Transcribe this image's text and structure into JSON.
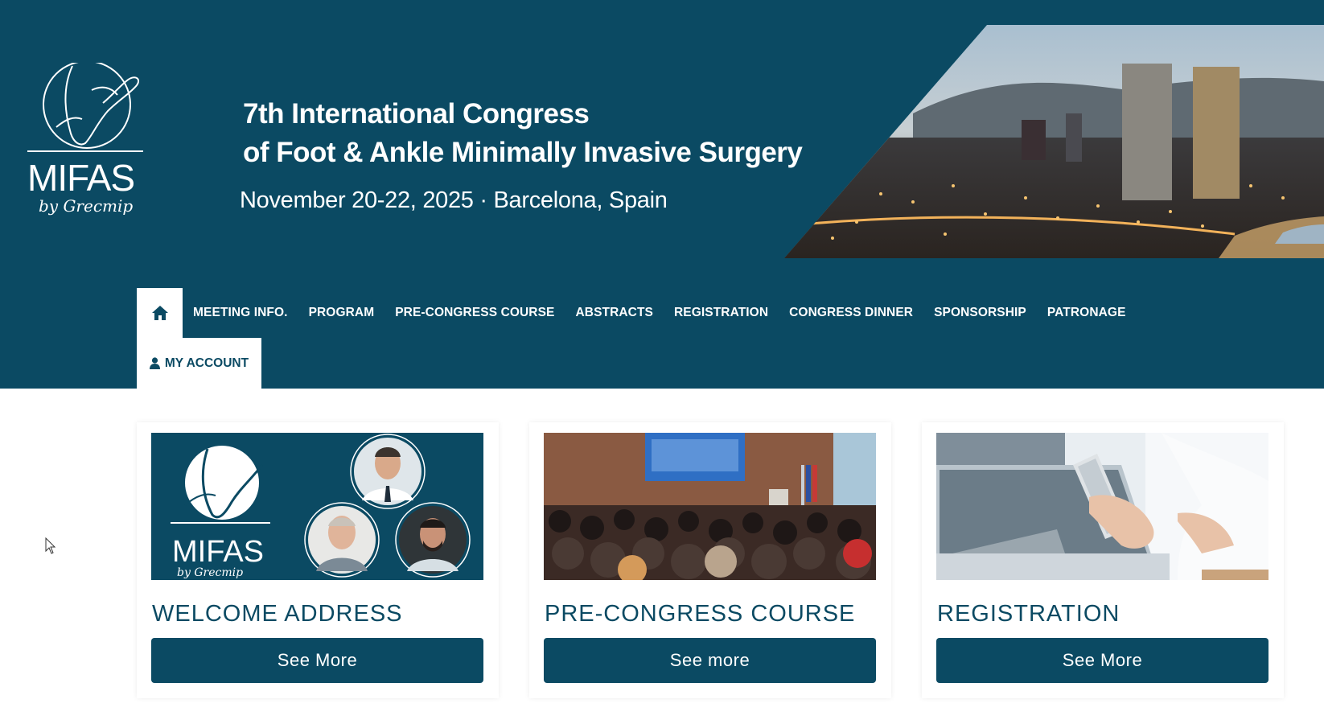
{
  "header": {
    "logo_text": "MIFAS",
    "logo_sub": "by Grecmip",
    "title_lines": [
      "7th International Congress",
      "of Foot & Ankle Minimally Invasive Surgery"
    ],
    "subtitle": "November 20-22, 2025  ·  Barcelona, Spain"
  },
  "nav": {
    "home_icon": "home-icon",
    "items": [
      "MEETING INFO.",
      "PROGRAM",
      "PRE-CONGRESS COURSE",
      "ABSTRACTS",
      "REGISTRATION",
      "CONGRESS DINNER",
      "SPONSORSHIP",
      "PATRONAGE"
    ],
    "account_label": "MY ACCOUNT",
    "account_icon": "user-icon"
  },
  "cards": [
    {
      "title": "WELCOME ADDRESS",
      "button": "See More",
      "image": "welcome-image"
    },
    {
      "title": "PRE-CONGRESS COURSE",
      "button": "See more",
      "image": "conference-audience-image"
    },
    {
      "title": "REGISTRATION",
      "button": "See More",
      "image": "laptop-phone-image"
    }
  ],
  "colors": {
    "brand": "#0b4a63",
    "text_on_brand": "#ffffff"
  }
}
